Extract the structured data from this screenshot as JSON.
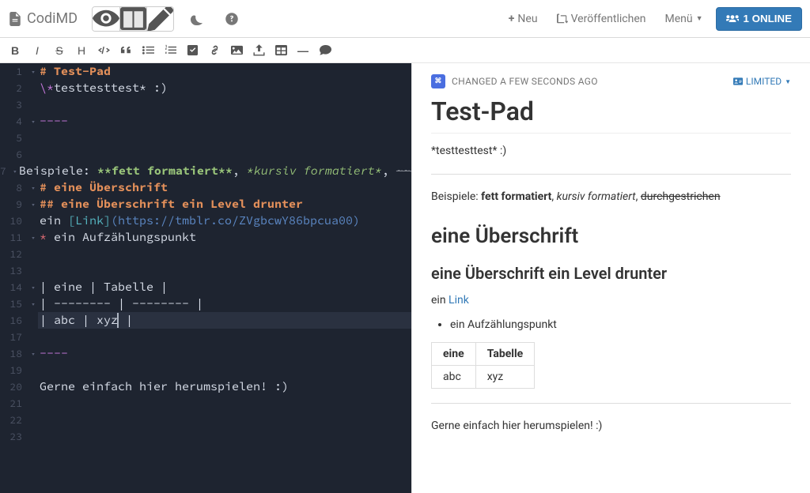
{
  "brand": "CodiMD",
  "nav": {
    "new": "Neu",
    "publish": "Veröffentlichen",
    "menu": "Menü",
    "online": "1 ONLINE"
  },
  "status": {
    "changed": "CHANGED A FEW SECONDS AGO",
    "permission": "LIMITED"
  },
  "editor": {
    "lines": [
      {
        "n": 1,
        "fold": true,
        "segs": [
          {
            "c": "cm-h1",
            "t": "# Test-Pad"
          }
        ]
      },
      {
        "n": 2,
        "segs": [
          {
            "c": "cm-esc",
            "t": "\\*"
          },
          {
            "t": "testtesttest* :)"
          }
        ]
      },
      {
        "n": 3,
        "segs": []
      },
      {
        "n": 4,
        "fold": true,
        "segs": [
          {
            "c": "cm-hr",
            "t": "----"
          }
        ]
      },
      {
        "n": 5,
        "segs": []
      },
      {
        "n": 6,
        "segs": []
      },
      {
        "n": 7,
        "fold": true,
        "segs": [
          {
            "c": "cm-def",
            "t": "Beispiele: "
          },
          {
            "c": "cm-bold",
            "t": "**fett formatiert**"
          },
          {
            "c": "cm-def",
            "t": ", "
          },
          {
            "c": "cm-ital",
            "t": "*kursiv formatiert*"
          },
          {
            "c": "cm-def",
            "t": ", "
          },
          {
            "c": "cm-strike",
            "t": "~~durchgestrichen~~"
          }
        ]
      },
      {
        "n": 8,
        "fold": true,
        "segs": [
          {
            "c": "cm-h2",
            "t": "# eine Überschrift"
          }
        ]
      },
      {
        "n": 9,
        "fold": true,
        "segs": [
          {
            "c": "cm-h3",
            "t": "## eine Überschrift ein Level drunter"
          }
        ]
      },
      {
        "n": 10,
        "segs": [
          {
            "c": "cm-def",
            "t": "ein "
          },
          {
            "c": "cm-linktxt",
            "t": "[Link]"
          },
          {
            "c": "cm-linkurl",
            "t": "(https://tmblr.co/ZVgbcwY86bpcua00)"
          }
        ]
      },
      {
        "n": 11,
        "fold": true,
        "segs": [
          {
            "c": "cm-bullet",
            "t": "* "
          },
          {
            "c": "cm-def",
            "t": "ein Aufzählungspunkt"
          }
        ]
      },
      {
        "n": 12,
        "segs": []
      },
      {
        "n": 13,
        "segs": []
      },
      {
        "n": 14,
        "fold": true,
        "segs": [
          {
            "c": "cm-def",
            "t": "| eine | Tabelle |"
          }
        ]
      },
      {
        "n": 15,
        "fold": true,
        "segs": [
          {
            "c": "cm-def",
            "t": "| -------- | -------- |"
          }
        ]
      },
      {
        "n": 16,
        "cursorAfter": true,
        "segs": [
          {
            "c": "cm-def",
            "t": "| abc | xyz"
          },
          {
            "cursor": true
          },
          {
            "c": "cm-def",
            "t": " |"
          }
        ]
      },
      {
        "n": 17,
        "segs": []
      },
      {
        "n": 18,
        "fold": true,
        "segs": [
          {
            "c": "cm-hr",
            "t": "----"
          }
        ]
      },
      {
        "n": 19,
        "segs": []
      },
      {
        "n": 20,
        "segs": [
          {
            "c": "cm-def",
            "t": "Gerne einfach hier herumspielen! :)"
          }
        ]
      },
      {
        "n": 21,
        "segs": []
      },
      {
        "n": 22,
        "segs": []
      },
      {
        "n": 23,
        "segs": []
      }
    ]
  },
  "preview": {
    "title": "Test-Pad",
    "p1_pre": "*testtesttest* :)",
    "p2_prefix": "Beispiele: ",
    "p2_bold": "fett formatiert",
    "p2_sep1": ", ",
    "p2_ital": "kursiv formatiert",
    "p2_sep2": ", ",
    "p2_strike": "durchgestrichen",
    "h2": "eine Überschrift",
    "h3": "eine Überschrift ein Level drunter",
    "link_pre": "ein ",
    "link_text": "Link",
    "bullet": "ein Aufzählungspunkt",
    "table": {
      "h1": "eine",
      "h2": "Tabelle",
      "c1": "abc",
      "c2": "xyz"
    },
    "outro": "Gerne einfach hier herumspielen! :)"
  }
}
